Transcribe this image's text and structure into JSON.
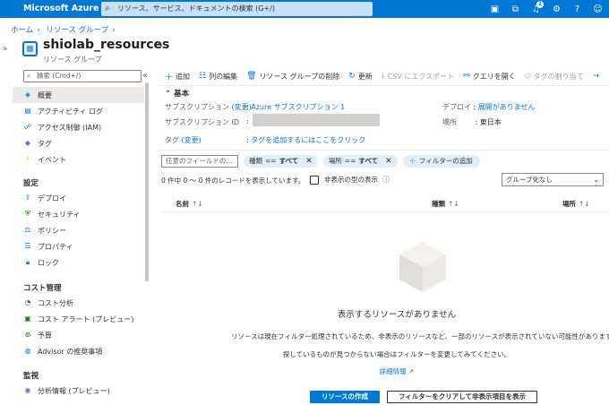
{
  "topbar": {
    "brand": "Microsoft Azure",
    "search_placeholder": "リソース、サービス、ドキュメントの検索 (G+/)",
    "notification_count": "2"
  },
  "breadcrumb": [
    "ホーム",
    "リソース グループ"
  ],
  "header": {
    "title": "shiolab_resources",
    "subtitle": "リソース グループ"
  },
  "sidebar": {
    "search_placeholder": "検索 (Cmd+/)",
    "items": [
      {
        "label": "概要",
        "icon": "overview-icon"
      },
      {
        "label": "アクティビティ ログ",
        "icon": "activity-log-icon"
      },
      {
        "label": "アクセス制御 (IAM)",
        "icon": "iam-icon"
      },
      {
        "label": "タグ",
        "icon": "tag-icon"
      },
      {
        "label": "イベント",
        "icon": "event-icon"
      }
    ],
    "section_settings": "設定",
    "settings_items": [
      {
        "label": "デプロイ",
        "icon": "deploy-icon"
      },
      {
        "label": "セキュリティ",
        "icon": "security-icon"
      },
      {
        "label": "ポリシー",
        "icon": "policy-icon"
      },
      {
        "label": "プロパティ",
        "icon": "properties-icon"
      },
      {
        "label": "ロック",
        "icon": "lock-icon"
      }
    ],
    "section_cost": "コスト管理",
    "cost_items": [
      {
        "label": "コスト分析",
        "icon": "cost-analysis-icon"
      },
      {
        "label": "コスト アラート (プレビュー)",
        "icon": "cost-alert-icon"
      },
      {
        "label": "予算",
        "icon": "budget-icon"
      },
      {
        "label": "Advisor の推奨事項",
        "icon": "advisor-icon"
      }
    ],
    "section_monitor": "監視",
    "monitor_items": [
      {
        "label": "分析情報 (プレビュー)",
        "icon": "insights-icon"
      }
    ]
  },
  "toolbar": {
    "add": "追加",
    "edit_columns": "列の編集",
    "delete_rg": "リソース グループの削除",
    "refresh": "更新",
    "export_csv": "CSV にエクスポート",
    "open_query": "クエリを開く",
    "assign_tags": "タグの割り当て"
  },
  "essentials": {
    "heading": "基本",
    "subscription_label": "サブスクリプション",
    "change": "(変更)",
    "subscription_value": "Azure サブスクリプション 1",
    "subscription_id_label": "サブスクリプション ID",
    "tags_label": "タグ",
    "tags_value": "タグを追加するにはここをクリック",
    "deploy_label": "デプロイ",
    "deploy_value": "展開がありません",
    "location_label": "場所",
    "location_value": "東日本",
    "colon": ":"
  },
  "filters": {
    "field_placeholder": "任意のフィールドの...",
    "type_name": "種類",
    "type_op": "==",
    "type_value": "すべて",
    "location_name": "場所",
    "location_op": "==",
    "location_value": "すべて",
    "add_filter": "フィルターの追加"
  },
  "list": {
    "count_text": "0 件中 0 ～ 0 件のレコードを表示しています。",
    "show_hidden": "非表示の型の表示",
    "group_by": "グループ化なし",
    "columns": [
      "名前",
      "種類",
      "場所"
    ]
  },
  "empty": {
    "title": "表示するリソースがありません",
    "line1": "リソースは現在フィルター処理されているため、非表示のリソースなど、一部のリソースが表示されていない可能性があります",
    "line2": "探しているものが見つからない場合はフィルターを変更してみてください。",
    "learn_more": "詳細情報",
    "create_button": "リソースの作成",
    "clear_button": "フィルターをクリアして非表示項目を表示"
  },
  "colors": {
    "accent": "#0078d4",
    "pill": "#e1eef9"
  }
}
